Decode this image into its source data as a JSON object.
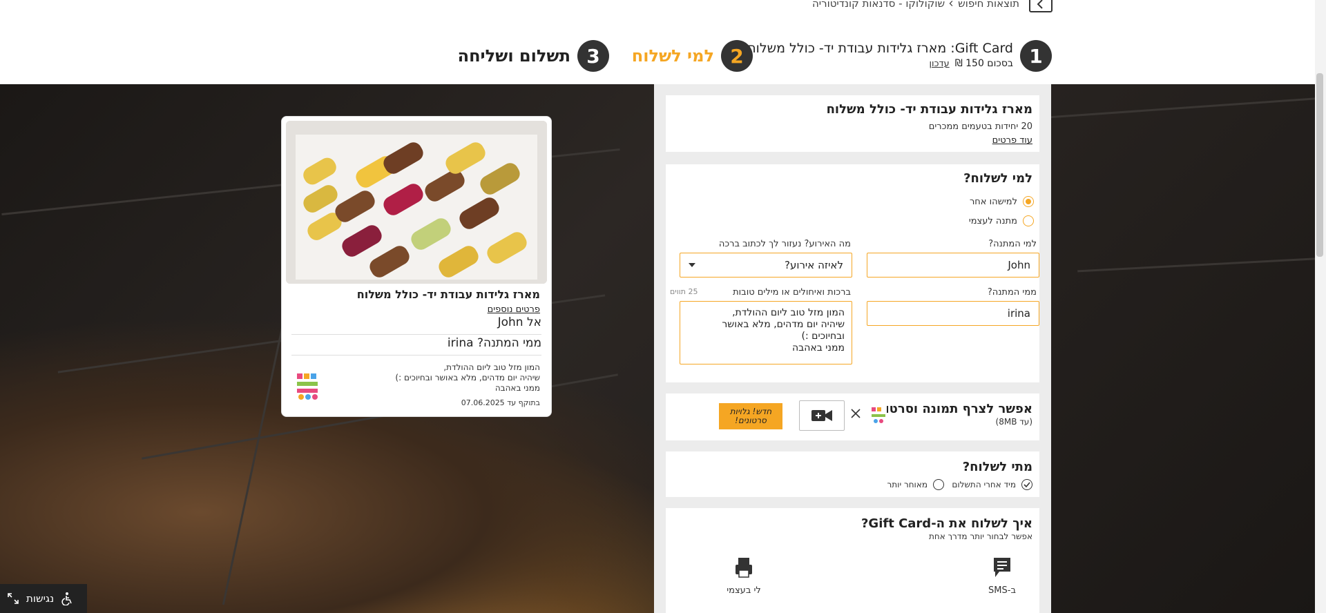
{
  "header": {
    "breadcrumb": [
      "תוצאות חיפוש",
      "שוקולוקו - סדנאות קונדיטוריה"
    ],
    "steps": [
      {
        "number": "1",
        "title_brand": "Gift Card",
        "title_rest": ": מארז גלידות עבודת יד- כולל משלוח",
        "subtitle": "בסכום 150 ₪",
        "edit_link": "עדכון"
      },
      {
        "number": "2",
        "title": "למי לשלוח"
      },
      {
        "number": "3",
        "title": "תשלום ושליחה"
      }
    ]
  },
  "product_card": {
    "title": "מארז גלידות עבודת יד- כולל משלוח",
    "subtitle": "20 יחידות בטעמים ממכרים",
    "more_link": "עוד פרטים"
  },
  "recipient": {
    "heading": "למי לשלוח?",
    "options": [
      "למישהו אחר",
      "מתנה לעצמי"
    ],
    "to_label": "למי המתנה?",
    "to_value": "John",
    "occasion_label": "מה האירוע? נעזור לך לכתוב ברכה",
    "occasion_value": "לאיזה אירוע?",
    "from_label": "ממי המתנה?",
    "from_value": "irina",
    "greeting_label": "ברכות ואיחולים או מילים טובות",
    "greeting_counter": "25 תווים",
    "greeting_value": "המון מזל טוב ליום ההולדת,\nשיהיה יום מדהים, מלא באושר ובחיוכים :)\nממני באהבה"
  },
  "media": {
    "heading": "אפשר לצרף תמונה וסרטון",
    "limit": "(עד 8MB)",
    "badge": "חדש! גלויות סרטונים!"
  },
  "timing": {
    "heading": "מתי לשלוח?",
    "options": [
      "מיד אחרי התשלום",
      "מאוחר יותר"
    ]
  },
  "delivery": {
    "heading": "איך לשלוח את ה-Gift Card?",
    "subtitle": "אפשר לבחור יותר מדרך אחת",
    "options": [
      "ב-SMS",
      "לי בעצמי"
    ]
  },
  "preview": {
    "title": "מארז גלידות עבודת יד- כולל משלוח",
    "details_link": "פרטים נוספים",
    "to_prefix": "אל",
    "to_value": "John",
    "from_prefix": "ממי המתנה?",
    "from_value": "irina",
    "message": "המון מזל טוב ליום ההולדת,\nשיהיה יום מדהים, מלא באושר ובחיוכים :)\nממני באהבה",
    "valid_until": "בתוקף עד 07.06.2025"
  },
  "accessibility": {
    "label": "נגישות"
  },
  "colors": {
    "accent": "#f5a623",
    "dark": "#333333",
    "panel_bg": "#ececec"
  }
}
